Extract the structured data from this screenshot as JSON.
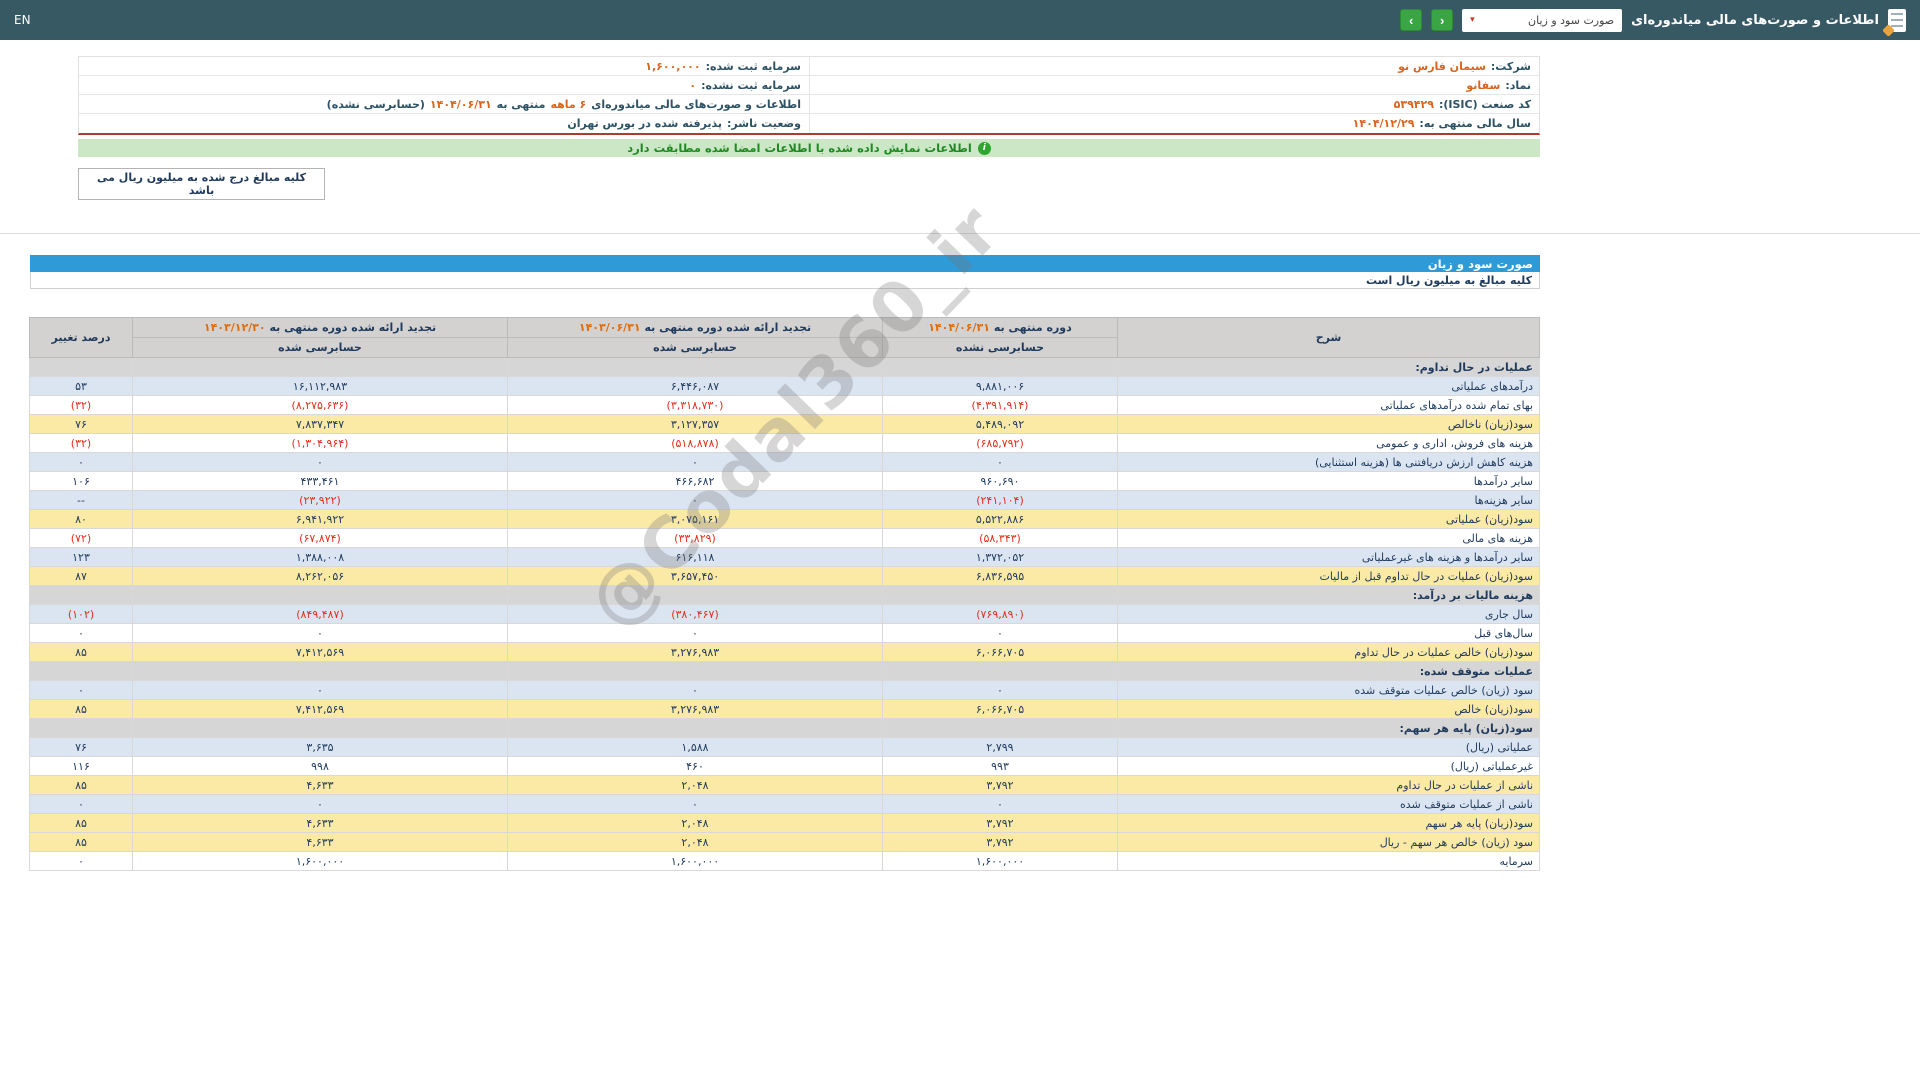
{
  "topbar": {
    "title": "اطلاعات و صورت‌های مالی میاندوره‌ای",
    "statement_dropdown": "صورت سود و زیان",
    "dropdown_caret": "▾",
    "prev_glyph": "‹",
    "next_glyph": "›",
    "lang": "EN"
  },
  "company_info": {
    "company_label": "شرکت:",
    "company_value": "سیمان فارس نو",
    "symbol_label": "نماد:",
    "symbol_value": "سفانو",
    "isic_label": "کد صنعت (ISIC):",
    "isic_value": "۵۳۹۴۲۹",
    "fiscal_label": "سال مالی منتهی به:",
    "fiscal_value": "۱۴۰۴/۱۲/۲۹",
    "capital_label": "سرمایه ثبت شده:",
    "capital_value": "۱,۶۰۰,۰۰۰",
    "unregistered_label": "سرمایه ثبت نشده:",
    "unregistered_value": "۰",
    "period_label": "اطلاعات و صورت‌های مالی میاندوره‌ای",
    "period_months": "۶ ماهه",
    "period_middle": "منتهی به",
    "period_date": "۱۴۰۴/۰۶/۳۱",
    "period_suffix": "(حسابرسی نشده)",
    "status_label": "وضعیت ناشر:",
    "status_value": "پذیرفته شده در بورس تهران"
  },
  "banner": {
    "text": "اطلاعات نمایش داده شده با اطلاعات امضا شده مطابقت دارد",
    "icon_glyph": "i"
  },
  "units_box": "کلیه مبالغ درج شده به میلیون ریال می باشد",
  "statement": {
    "title_bar": "صورت سود و زیان",
    "units_note": "کلیه مبالغ به میلیون ریال است"
  },
  "table": {
    "headers": {
      "description": "شرح",
      "change": "درصد تغییر",
      "current": {
        "prefix": "دوره منتهی به",
        "date": "۱۴۰۴/۰۶/۳۱",
        "sub": "حسابرسی نشده"
      },
      "midyear": {
        "prefix": "تجدید ارائه شده دوره منتهی به",
        "date": "۱۴۰۳/۰۶/۳۱",
        "sub": "حسابرسی شده"
      },
      "year": {
        "prefix": "تجدید ارائه شده دوره منتهی به",
        "date": "۱۴۰۳/۱۲/۳۰",
        "sub": "حسابرسی شده"
      }
    },
    "rows": [
      {
        "kind": "section",
        "label": "عملیات در حال تداوم:"
      },
      {
        "kind": "alt",
        "label": "درآمدهای عملیاتی",
        "current": "۹,۸۸۱,۰۰۶",
        "prev": "۶,۴۴۶,۰۸۷",
        "year": "۱۶,۱۱۲,۹۸۳",
        "change": "۵۳"
      },
      {
        "kind": "plain",
        "label": "بهای تمام شده درآمدهای عملیاتی",
        "current": "(۴,۳۹۱,۹۱۴)",
        "prev": "(۳,۳۱۸,۷۳۰)",
        "year": "(۸,۲۷۵,۶۳۶)",
        "change": "(۳۲)"
      },
      {
        "kind": "total",
        "label": "سود(زیان) ناخالص",
        "current": "۵,۴۸۹,۰۹۲",
        "prev": "۳,۱۲۷,۳۵۷",
        "year": "۷,۸۳۷,۳۴۷",
        "change": "۷۶"
      },
      {
        "kind": "plain",
        "label": "هزینه های فروش، اداری و عمومی",
        "current": "(۶۸۵,۷۹۲)",
        "prev": "(۵۱۸,۸۷۸)",
        "year": "(۱,۳۰۴,۹۶۴)",
        "change": "(۳۲)"
      },
      {
        "kind": "alt",
        "label": "هزینه کاهش ارزش دریافتنی ها (هزینه استثنایی)",
        "current": "۰",
        "prev": "۰",
        "year": "۰",
        "change": "۰"
      },
      {
        "kind": "plain",
        "label": "سایر درآمدها",
        "current": "۹۶۰,۶۹۰",
        "prev": "۴۶۶,۶۸۲",
        "year": "۴۳۳,۴۶۱",
        "change": "۱۰۶"
      },
      {
        "kind": "alt",
        "label": "سایر هزینه‌ها",
        "current": "(۲۴۱,۱۰۴)",
        "prev": "۰",
        "year": "(۲۳,۹۲۲)",
        "change": "--"
      },
      {
        "kind": "total",
        "label": "سود(زیان) عملیاتی",
        "current": "۵,۵۲۲,۸۸۶",
        "prev": "۳,۰۷۵,۱۶۱",
        "year": "۶,۹۴۱,۹۲۲",
        "change": "۸۰"
      },
      {
        "kind": "plain",
        "label": "هزینه های مالی",
        "current": "(۵۸,۳۴۳)",
        "prev": "(۳۳,۸۲۹)",
        "year": "(۶۷,۸۷۴)",
        "change": "(۷۲)"
      },
      {
        "kind": "alt",
        "label": "سایر درآمدها و هزینه های غیرعملیاتی",
        "current": "۱,۳۷۲,۰۵۲",
        "prev": "۶۱۶,۱۱۸",
        "year": "۱,۳۸۸,۰۰۸",
        "change": "۱۲۳"
      },
      {
        "kind": "total",
        "label": "سود(زیان) عملیات در حال تداوم قبل از مالیات",
        "current": "۶,۸۳۶,۵۹۵",
        "prev": "۳,۶۵۷,۴۵۰",
        "year": "۸,۲۶۲,۰۵۶",
        "change": "۸۷"
      },
      {
        "kind": "section",
        "label": "هزینه مالیات بر درآمد:"
      },
      {
        "kind": "alt",
        "label": "سال جاری",
        "current": "(۷۶۹,۸۹۰)",
        "prev": "(۳۸۰,۴۶۷)",
        "year": "(۸۴۹,۴۸۷)",
        "change": "(۱۰۲)"
      },
      {
        "kind": "plain",
        "label": "سال‌های قبل",
        "current": "۰",
        "prev": "۰",
        "year": "۰",
        "change": "۰"
      },
      {
        "kind": "total",
        "label": "سود(زیان) خالص عملیات در حال تداوم",
        "current": "۶,۰۶۶,۷۰۵",
        "prev": "۳,۲۷۶,۹۸۳",
        "year": "۷,۴۱۲,۵۶۹",
        "change": "۸۵"
      },
      {
        "kind": "section",
        "label": "عملیات متوقف شده:"
      },
      {
        "kind": "alt",
        "label": "سود (زیان) خالص عملیات متوقف شده",
        "current": "۰",
        "prev": "۰",
        "year": "۰",
        "change": "۰"
      },
      {
        "kind": "total",
        "label": "سود(زیان) خالص",
        "current": "۶,۰۶۶,۷۰۵",
        "prev": "۳,۲۷۶,۹۸۳",
        "year": "۷,۴۱۲,۵۶۹",
        "change": "۸۵"
      },
      {
        "kind": "section",
        "label": "سود(زیان) پایه هر سهم:"
      },
      {
        "kind": "alt",
        "label": "عملیاتی (ریال)",
        "current": "۲,۷۹۹",
        "prev": "۱,۵۸۸",
        "year": "۳,۶۳۵",
        "change": "۷۶"
      },
      {
        "kind": "plain",
        "label": "غیرعملیاتی (ریال)",
        "current": "۹۹۳",
        "prev": "۴۶۰",
        "year": "۹۹۸",
        "change": "۱۱۶"
      },
      {
        "kind": "total",
        "label": "ناشی از عملیات در حال تداوم",
        "current": "۳,۷۹۲",
        "prev": "۲,۰۴۸",
        "year": "۴,۶۳۳",
        "change": "۸۵"
      },
      {
        "kind": "alt",
        "label": "ناشی از عملیات متوقف شده",
        "current": "۰",
        "prev": "۰",
        "year": "۰",
        "change": "۰"
      },
      {
        "kind": "total",
        "label": "سود(زیان) پایه هر سهم",
        "current": "۳,۷۹۲",
        "prev": "۲,۰۴۸",
        "year": "۴,۶۳۳",
        "change": "۸۵"
      },
      {
        "kind": "total",
        "label": "سود (زیان) خالص هر سهم - ریال",
        "current": "۳,۷۹۲",
        "prev": "۲,۰۴۸",
        "year": "۴,۶۳۳",
        "change": "۸۵"
      },
      {
        "kind": "plain",
        "label": "سرمایه",
        "current": "۱,۶۰۰,۰۰۰",
        "prev": "۱,۶۰۰,۰۰۰",
        "year": "۱,۶۰۰,۰۰۰",
        "change": "۰"
      }
    ]
  },
  "watermark": "@Codal360_ir",
  "colors": {
    "accent_blue": "#2e9ad7",
    "header_bar": "#375963",
    "highlight_yellow": "#fbe9a6",
    "row_alt_blue": "#dbe5f2",
    "section_gray": "#d6d6d6",
    "negative_red": "#e0301e",
    "value_orange": "#d9641e",
    "banner_green_bg": "#cbe7c5",
    "banner_green_text": "#1e8a22",
    "nav_green": "#3aa544"
  }
}
